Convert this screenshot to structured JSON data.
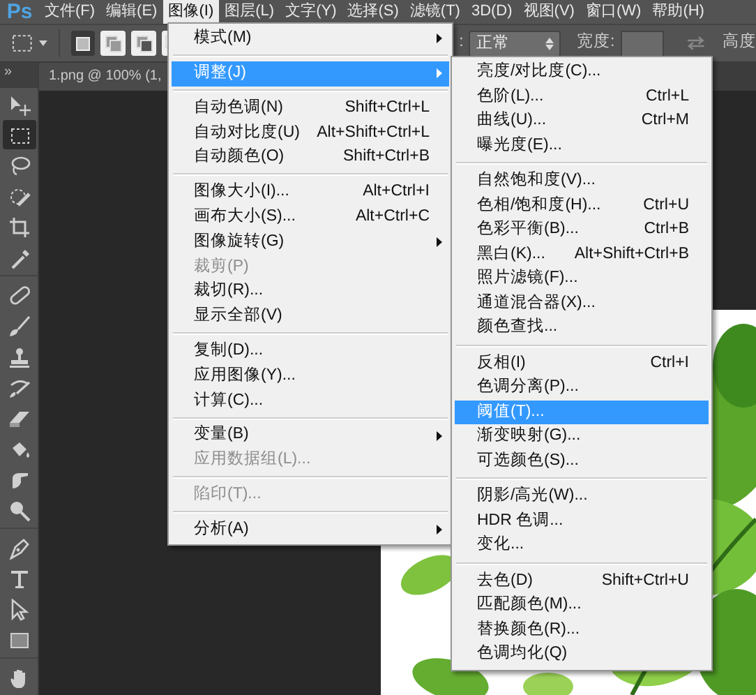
{
  "menubar": {
    "logo": "Ps",
    "items": [
      {
        "label": "文件(F)",
        "selected": false
      },
      {
        "label": "编辑(E)",
        "selected": false
      },
      {
        "label": "图像(I)",
        "selected": true
      },
      {
        "label": "图层(L)",
        "selected": false
      },
      {
        "label": "文字(Y)",
        "selected": false
      },
      {
        "label": "选择(S)",
        "selected": false
      },
      {
        "label": "滤镜(T)",
        "selected": false
      },
      {
        "label": "3D(D)",
        "selected": false
      },
      {
        "label": "视图(V)",
        "selected": false
      },
      {
        "label": "窗口(W)",
        "selected": false
      },
      {
        "label": "帮助(H)",
        "selected": false
      }
    ]
  },
  "options_bar": {
    "mode_buttons": [
      {
        "selected": true
      },
      {
        "selected": false
      },
      {
        "selected": false
      },
      {
        "selected": false
      }
    ],
    "style_label": ":",
    "style_value": "正常",
    "width_label": "宽度:",
    "height_label": "高度"
  },
  "toolbar": {
    "collapse": "»",
    "tools": [
      {
        "selected": false
      },
      {
        "selected": true
      },
      {
        "selected": false
      },
      {
        "selected": false
      },
      {
        "selected": false
      },
      {
        "selected": false
      },
      {
        "selected": false
      },
      {
        "selected": false
      },
      {
        "selected": false
      },
      {
        "selected": false
      },
      {
        "selected": false
      },
      {
        "selected": false
      },
      {
        "selected": false
      },
      {
        "selected": false
      },
      {
        "selected": false
      },
      {
        "selected": false
      },
      {
        "selected": false
      },
      {
        "selected": false
      },
      {
        "selected": false
      }
    ]
  },
  "document_tab": {
    "title": "1.png @ 100% (1,"
  },
  "image_menu": {
    "groups": [
      [
        {
          "label": "模式(M)",
          "submenu": true,
          "disabled": false,
          "selected": false
        }
      ],
      [
        {
          "label": "调整(J)",
          "submenu": true,
          "disabled": false,
          "selected": true
        }
      ],
      [
        {
          "label": "自动色调(N)",
          "shortcut": "Shift+Ctrl+L",
          "submenu": false,
          "disabled": false,
          "selected": false
        },
        {
          "label": "自动对比度(U)",
          "shortcut": "Alt+Shift+Ctrl+L",
          "submenu": false,
          "disabled": false,
          "selected": false
        },
        {
          "label": "自动颜色(O)",
          "shortcut": "Shift+Ctrl+B",
          "submenu": false,
          "disabled": false,
          "selected": false
        }
      ],
      [
        {
          "label": "图像大小(I)...",
          "shortcut": "Alt+Ctrl+I",
          "submenu": false,
          "disabled": false,
          "selected": false
        },
        {
          "label": "画布大小(S)...",
          "shortcut": "Alt+Ctrl+C",
          "submenu": false,
          "disabled": false,
          "selected": false
        },
        {
          "label": "图像旋转(G)",
          "submenu": true,
          "disabled": false,
          "selected": false
        },
        {
          "label": "裁剪(P)",
          "submenu": false,
          "disabled": true,
          "selected": false
        },
        {
          "label": "裁切(R)...",
          "submenu": false,
          "disabled": false,
          "selected": false
        },
        {
          "label": "显示全部(V)",
          "submenu": false,
          "disabled": false,
          "selected": false
        }
      ],
      [
        {
          "label": "复制(D)...",
          "submenu": false,
          "disabled": false,
          "selected": false
        },
        {
          "label": "应用图像(Y)...",
          "submenu": false,
          "disabled": false,
          "selected": false
        },
        {
          "label": "计算(C)...",
          "submenu": false,
          "disabled": false,
          "selected": false
        }
      ],
      [
        {
          "label": "变量(B)",
          "submenu": true,
          "disabled": false,
          "selected": false
        },
        {
          "label": "应用数据组(L)...",
          "submenu": false,
          "disabled": true,
          "selected": false
        }
      ],
      [
        {
          "label": "陷印(T)...",
          "submenu": false,
          "disabled": true,
          "selected": false
        }
      ],
      [
        {
          "label": "分析(A)",
          "submenu": true,
          "disabled": false,
          "selected": false
        }
      ]
    ]
  },
  "adjust_submenu": {
    "groups": [
      [
        {
          "label": "亮度/对比度(C)...",
          "selected": false
        },
        {
          "label": "色阶(L)...",
          "shortcut": "Ctrl+L",
          "selected": false
        },
        {
          "label": "曲线(U)...",
          "shortcut": "Ctrl+M",
          "selected": false
        },
        {
          "label": "曝光度(E)...",
          "selected": false
        }
      ],
      [
        {
          "label": "自然饱和度(V)...",
          "selected": false
        },
        {
          "label": "色相/饱和度(H)...",
          "shortcut": "Ctrl+U",
          "selected": false
        },
        {
          "label": "色彩平衡(B)...",
          "shortcut": "Ctrl+B",
          "selected": false
        },
        {
          "label": "黑白(K)...",
          "shortcut": "Alt+Shift+Ctrl+B",
          "selected": false
        },
        {
          "label": "照片滤镜(F)...",
          "selected": false
        },
        {
          "label": "通道混合器(X)...",
          "selected": false
        },
        {
          "label": "颜色查找...",
          "selected": false
        }
      ],
      [
        {
          "label": "反相(I)",
          "shortcut": "Ctrl+I",
          "selected": false
        },
        {
          "label": "色调分离(P)...",
          "selected": false
        },
        {
          "label": "阈值(T)...",
          "selected": true
        },
        {
          "label": "渐变映射(G)...",
          "selected": false
        },
        {
          "label": "可选颜色(S)...",
          "selected": false
        }
      ],
      [
        {
          "label": "阴影/高光(W)...",
          "selected": false
        },
        {
          "label": "HDR 色调...",
          "selected": false
        },
        {
          "label": "变化...",
          "selected": false
        }
      ],
      [
        {
          "label": "去色(D)",
          "shortcut": "Shift+Ctrl+U",
          "selected": false
        },
        {
          "label": "匹配颜色(M)...",
          "selected": false
        },
        {
          "label": "替换颜色(R)...",
          "selected": false
        },
        {
          "label": "色调均化(Q)",
          "selected": false
        }
      ]
    ]
  }
}
